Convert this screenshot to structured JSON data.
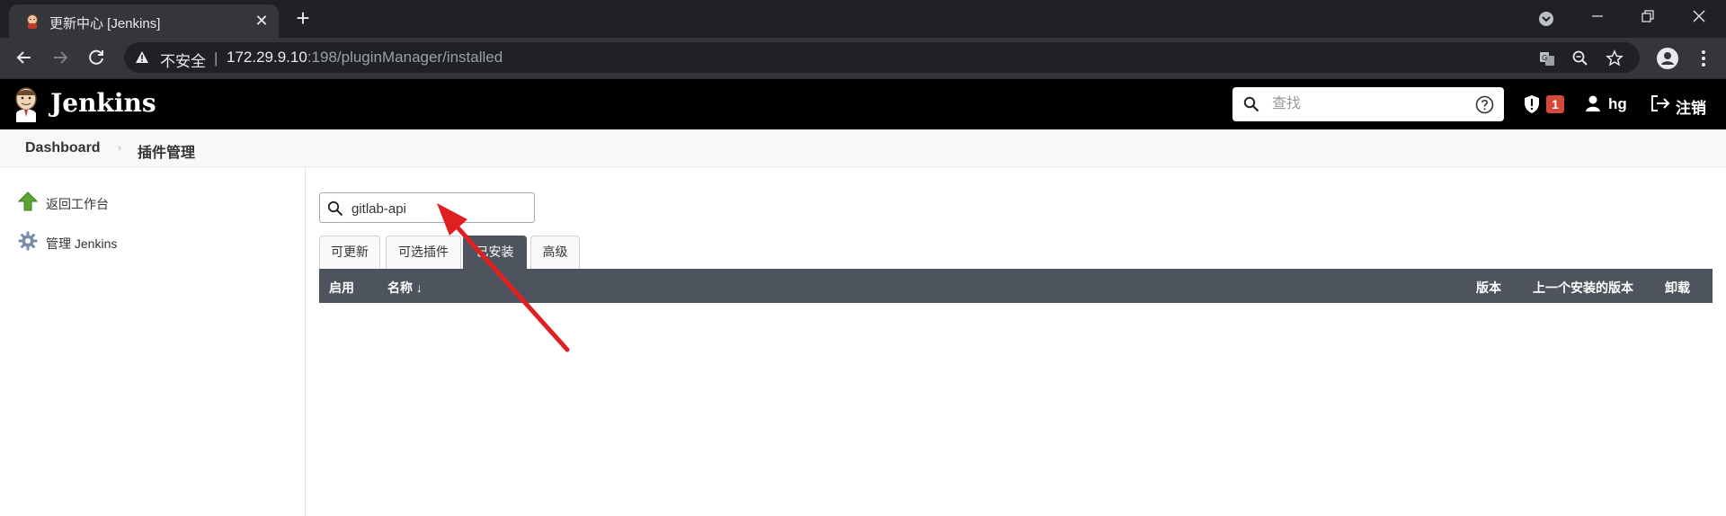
{
  "browser": {
    "tab_title": "更新中心 [Jenkins]",
    "new_tab_symbol": "+",
    "close_symbol": "✕",
    "address": {
      "security_label": "不安全",
      "separator": "|",
      "host": "172.29.9.10",
      "path": ":198/pluginManager/installed"
    }
  },
  "header": {
    "title": "Jenkins",
    "search_placeholder": "查找",
    "security_badge_count": "1",
    "username": "hg",
    "logout_label": "注销"
  },
  "breadcrumb": {
    "items": [
      "Dashboard",
      "插件管理"
    ]
  },
  "sidepanel": {
    "items": [
      {
        "label": "返回工作台",
        "icon": "up-arrow-icon"
      },
      {
        "label": "管理 Jenkins",
        "icon": "gear-icon"
      }
    ]
  },
  "main": {
    "filter_value": "gitlab-api",
    "tabs": [
      {
        "label": "可更新",
        "active": false
      },
      {
        "label": "可选插件",
        "active": false
      },
      {
        "label": "已安装",
        "active": true
      },
      {
        "label": "高级",
        "active": false
      }
    ],
    "table": {
      "headers": [
        "启用",
        "名称 ↓",
        "版本",
        "上一个安装的版本",
        "卸载"
      ]
    }
  },
  "colors": {
    "jenkins_header_bg": "#000000",
    "table_header_bg": "#4d545d",
    "badge_red": "#d24939",
    "annotation_arrow": "#e02020"
  }
}
